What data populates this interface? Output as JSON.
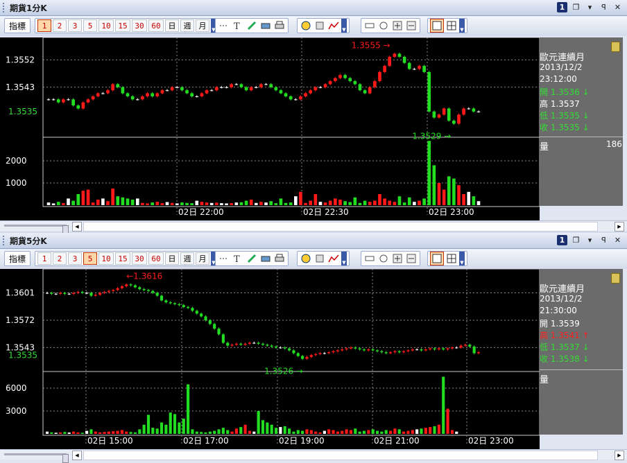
{
  "panels": [
    {
      "id": "p1",
      "title": "期貨1分K",
      "indicator_label": "指標",
      "periods": [
        "1",
        "2",
        "3",
        "5",
        "10",
        "15",
        "30",
        "60"
      ],
      "period_cjk": [
        "日",
        "週",
        "月"
      ],
      "selected_period": "1",
      "price_axis": [
        "1.3552",
        "1.3543",
        "1.3535"
      ],
      "volume_axis": [
        "2000",
        "1000"
      ],
      "time_labels": [
        "02日 22:00",
        "02日 22:30",
        "02日 23:00"
      ],
      "high_marker": "1.3555 →",
      "low_marker": "1.3529 →",
      "info": {
        "symbol": "歐元連續月",
        "date": "2013/12/2",
        "time": "23:12:00",
        "open": "開 1.3536 ↓",
        "high": "高 1.3537",
        "low": "低 1.3535 ↓",
        "close": "收 1.3535 ↓",
        "volume_label": "量",
        "volume_value": "186"
      }
    },
    {
      "id": "p2",
      "title": "期貨5分K",
      "indicator_label": "指標",
      "periods": [
        "1",
        "2",
        "3",
        "5",
        "10",
        "15",
        "30",
        "60"
      ],
      "period_cjk": [
        "日",
        "週",
        "月"
      ],
      "selected_period": "5",
      "price_axis": [
        "1.3601",
        "1.3572",
        "1.3543",
        "1.3535"
      ],
      "volume_axis": [
        "6000",
        "3000"
      ],
      "time_labels": [
        "02日 15:00",
        "02日 17:00",
        "02日 19:00",
        "02日 21:00",
        "02日 23:00"
      ],
      "high_marker": "←1.3616",
      "low_marker": "1.3526 →",
      "info": {
        "symbol": "歐元連續月",
        "date": "2013/12/2",
        "time": "21:30:00",
        "open": "開 1.3539",
        "high": "高 1.3541 ↑",
        "low": "低 1.3537 ↓",
        "close": "收 1.3538 ↓",
        "volume_label": "量",
        "volume_value": ""
      }
    }
  ],
  "colors": {
    "up": "#ff1a1a",
    "down": "#22dd22",
    "neutral": "#ffffff",
    "grid": "#8a8a8a",
    "axis_text": "#ffffff",
    "last_price": "#33dd33",
    "info_bg": "#6b6b6b"
  },
  "chart_data": [
    {
      "type": "candlestick",
      "title": "",
      "series": [
        {
          "name": "",
          "ohlc_note": "1-minute candles (approximate)",
          "close": [
            1.3539,
            1.3539,
            1.3538,
            1.3539,
            1.3539,
            1.3537,
            1.3536,
            1.3538,
            1.3539,
            1.354,
            1.3541,
            1.3541,
            1.3542,
            1.3544,
            1.3543,
            1.3541,
            1.354,
            1.3539,
            1.3539,
            1.354,
            1.3541,
            1.354,
            1.3541,
            1.3542,
            1.3542,
            1.3543,
            1.3543,
            1.3542,
            1.3541,
            1.354,
            1.354,
            1.3541,
            1.3542,
            1.3542,
            1.3543,
            1.3543,
            1.3543,
            1.3544,
            1.3544,
            1.3543,
            1.3542,
            1.3543,
            1.3543,
            1.3544,
            1.3544,
            1.3543,
            1.3542,
            1.3541,
            1.354,
            1.3539,
            1.3539,
            1.354,
            1.3541,
            1.3542,
            1.3543,
            1.3543,
            1.3544,
            1.3545,
            1.3546,
            1.3547,
            1.3546,
            1.3545,
            1.3544,
            1.3542,
            1.3541,
            1.3543,
            1.3545,
            1.3548,
            1.355,
            1.3553,
            1.3554,
            1.3553,
            1.3551,
            1.3549,
            1.3549,
            1.355,
            1.3548,
            1.3535,
            1.3533,
            1.3534,
            1.3536,
            1.3532,
            1.3531,
            1.3534,
            1.3536,
            1.3536,
            1.3535,
            1.3535
          ],
          "volume": [
            120,
            80,
            150,
            90,
            300,
            200,
            500,
            650,
            700,
            120,
            250,
            300,
            180,
            750,
            400,
            350,
            300,
            250,
            300,
            100,
            80,
            120,
            150,
            90,
            140,
            100,
            80,
            120,
            100,
            90,
            200,
            150,
            120,
            100,
            110,
            90,
            80,
            90,
            120,
            130,
            200,
            250,
            100,
            150,
            120,
            180,
            90,
            300,
            100,
            120,
            400,
            600,
            100,
            200,
            500,
            150,
            120,
            200,
            300,
            250,
            180,
            140,
            350,
            100,
            200,
            150,
            200,
            500,
            300,
            200,
            150,
            400,
            120,
            350,
            150,
            200,
            300,
            2900,
            1800,
            1000,
            700,
            1300,
            1200,
            900,
            500,
            600,
            400,
            180
          ],
          "volume_max": 3000
        }
      ],
      "ylim": [
        1.3527,
        1.3558
      ],
      "volume_ylim": [
        0,
        3000
      ]
    },
    {
      "type": "candlestick",
      "title": "",
      "series": [
        {
          "name": "",
          "ohlc_note": "5-minute candles (approximate)",
          "close": [
            1.3601,
            1.36,
            1.36,
            1.3601,
            1.36,
            1.36,
            1.3601,
            1.3602,
            1.3601,
            1.3601,
            1.3598,
            1.3599,
            1.3601,
            1.3602,
            1.3603,
            1.3604,
            1.3606,
            1.3608,
            1.361,
            1.3609,
            1.3607,
            1.3605,
            1.3604,
            1.3603,
            1.3601,
            1.3598,
            1.3593,
            1.3591,
            1.359,
            1.3589,
            1.3588,
            1.3586,
            1.3585,
            1.3582,
            1.3579,
            1.3576,
            1.3572,
            1.3568,
            1.3563,
            1.3557,
            1.3548,
            1.3545,
            1.3546,
            1.3547,
            1.3546,
            1.3547,
            1.3548,
            1.3548,
            1.3547,
            1.3546,
            1.3545,
            1.3544,
            1.3543,
            1.3543,
            1.3542,
            1.354,
            1.3537,
            1.3534,
            1.3531,
            1.3533,
            1.3535,
            1.3536,
            1.3537,
            1.3537,
            1.3538,
            1.3539,
            1.354,
            1.3541,
            1.3542,
            1.3543,
            1.3542,
            1.3541,
            1.354,
            1.3541,
            1.354,
            1.3539,
            1.3538,
            1.3537,
            1.3538,
            1.3539,
            1.3538,
            1.3539,
            1.354,
            1.3541,
            1.3541,
            1.354,
            1.3541,
            1.3542,
            1.3541,
            1.3542,
            1.3541,
            1.3542,
            1.3543,
            1.3543,
            1.3545,
            1.3546,
            1.3544,
            1.3537,
            1.3538
          ],
          "volume": [
            300,
            200,
            150,
            200,
            250,
            180,
            300,
            200,
            150,
            400,
            600,
            300,
            200,
            250,
            300,
            350,
            400,
            500,
            300,
            250,
            200,
            600,
            1200,
            2500,
            800,
            700,
            1500,
            1200,
            2800,
            2600,
            1500,
            2000,
            6500,
            600,
            300,
            250,
            200,
            300,
            400,
            600,
            800,
            500,
            300,
            700,
            900,
            1200,
            400,
            300,
            3000,
            1800,
            1500,
            1200,
            800,
            900,
            1000,
            700,
            300,
            500,
            400,
            600,
            500,
            300,
            200,
            400,
            600,
            500,
            300,
            400,
            600,
            500,
            700,
            300,
            400,
            500,
            600,
            400,
            300,
            500,
            400,
            700,
            600,
            300,
            400,
            500,
            600,
            700,
            800,
            900,
            1000,
            1200,
            7500,
            3300,
            500,
            300
          ],
          "volume_max": 8000
        }
      ],
      "ylim": [
        1.3519,
        1.3622
      ],
      "volume_ylim": [
        0,
        8000
      ]
    }
  ]
}
